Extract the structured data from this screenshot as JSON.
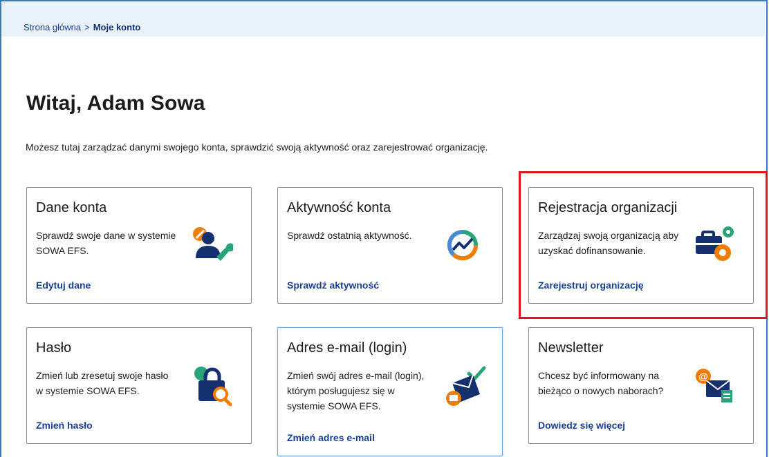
{
  "breadcrumb": {
    "home": "Strona główna",
    "separator": ">",
    "current": "Moje konto"
  },
  "page": {
    "title": "Witaj, Adam Sowa",
    "intro": "Możesz tutaj zarządzać danymi swojego konta, sprawdzić swoją aktywność oraz zarejestrować organizację."
  },
  "cards": [
    {
      "title": "Dane konta",
      "desc": "Sprawdź swoje dane w systemie SOWA EFS.",
      "link": "Edytuj dane",
      "icon": "user-wrench-icon"
    },
    {
      "title": "Aktywność konta",
      "desc": "Sprawdź ostatnią aktywność.",
      "link": "Sprawdź aktywność",
      "icon": "activity-chart-icon"
    },
    {
      "title": "Rejestracja organizacji",
      "desc": "Zarządzaj swoją organizacją aby uzyskać dofinansowanie.",
      "link": "Zarejestruj organizację",
      "icon": "briefcase-gears-icon"
    },
    {
      "title": "Hasło",
      "desc": "Zmień lub zresetuj swoje hasło w systemie SOWA EFS.",
      "link": "Zmień hasło",
      "icon": "padlock-search-icon"
    },
    {
      "title": "Adres e-mail (login)",
      "desc": "Zmień swój adres e-mail (login), którym posługujesz się w systemie SOWA EFS.",
      "link": "Zmień adres e-mail",
      "icon": "envelope-check-icon"
    },
    {
      "title": "Newsletter",
      "desc": "Chcesz być informowany na bieżąco o nowych naborach?",
      "link": "Dowiedz się więcej",
      "icon": "newsletter-envelope-icon"
    }
  ],
  "colors": {
    "navy": "#14306e",
    "link": "#1a3f8c",
    "orange": "#f07c00",
    "teal": "#2aa37a",
    "highlight": "#e0141b",
    "breadcrumb_bg": "#e9f1fb"
  }
}
